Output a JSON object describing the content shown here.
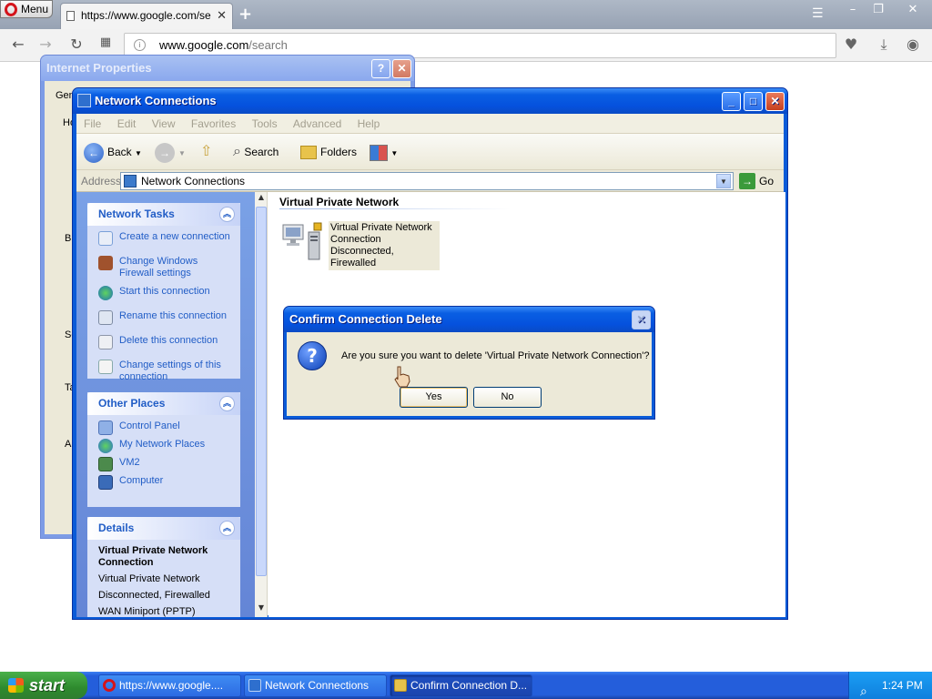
{
  "browser": {
    "menu_label": "Menu",
    "tab_title": "https://www.google.com/se",
    "address_host": "www.google.com",
    "address_path": "/search"
  },
  "ie_properties": {
    "title": "Internet Properties",
    "fragments": [
      "Gen",
      "Ho",
      "Br",
      "Se",
      "Ta",
      "Ap"
    ]
  },
  "network_window": {
    "title": "Network Connections",
    "menu": [
      "File",
      "Edit",
      "View",
      "Favorites",
      "Tools",
      "Advanced",
      "Help"
    ],
    "toolbar": {
      "back": "Back",
      "search": "Search",
      "folders": "Folders"
    },
    "address_label": "Address",
    "address_value": "Network Connections",
    "go_label": "Go",
    "tasks_panel": {
      "title": "Network Tasks",
      "items": [
        "Create a new connection",
        "Change Windows Firewall settings",
        "Start this connection",
        "Rename this connection",
        "Delete this connection",
        "Change settings of this connection"
      ]
    },
    "places_panel": {
      "title": "Other Places",
      "items": [
        "Control Panel",
        "My Network Places",
        "VM2",
        "Computer"
      ]
    },
    "details_panel": {
      "title": "Details",
      "name": "Virtual Private Network Connection",
      "type": "Virtual Private Network",
      "status": "Disconnected, Firewalled",
      "device": "WAN Miniport (PPTP)"
    },
    "group_header": "Virtual Private Network",
    "connection": {
      "name": "Virtual Private Network Connection",
      "status": "Disconnected, Firewalled"
    }
  },
  "dialog": {
    "title": "Confirm Connection Delete",
    "message": "Are you sure you want to delete 'Virtual Private Network Connection'?",
    "yes_label": "Yes",
    "no_label": "No"
  },
  "taskbar": {
    "start_label": "start",
    "tasks": [
      "https://www.google....",
      "Network Connections",
      "Confirm Connection D..."
    ],
    "clock": "1:24 PM"
  },
  "colors": {
    "xp_blue": "#0551dd",
    "taskbar_blue": "#245edb",
    "link_blue": "#215dc6",
    "start_green": "#2e8a2e"
  }
}
